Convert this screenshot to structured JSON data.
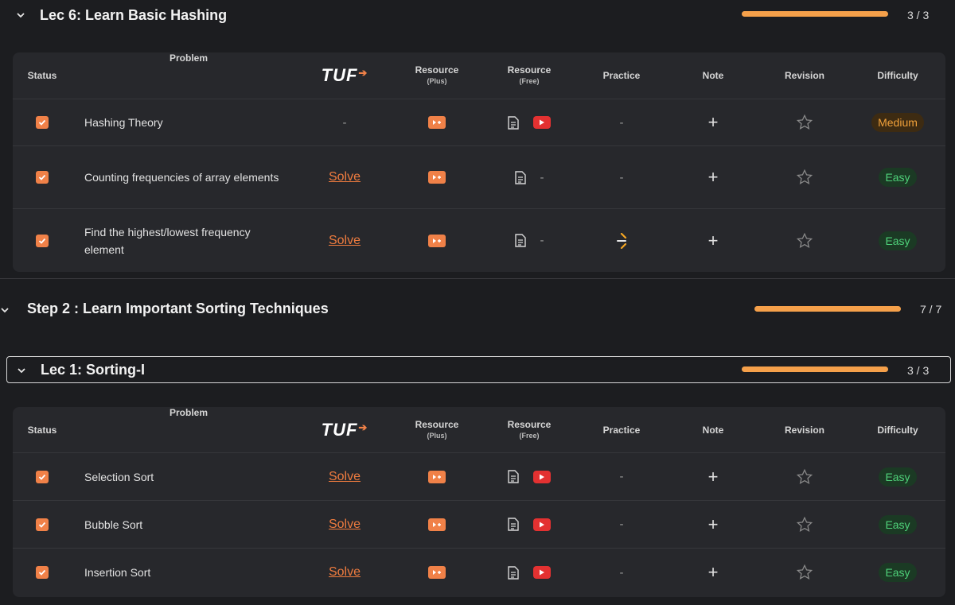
{
  "colors": {
    "accent": "#f08148",
    "progress": "#f5a04a",
    "easy": "#4fd27a",
    "medium": "#f1a13a",
    "youtube": "#e33131"
  },
  "table_headers": {
    "status": "Status",
    "problem": "Problem",
    "tuf": "TUF",
    "resource_plus": "Resource",
    "resource_plus_sub": "(Plus)",
    "resource_free": "Resource",
    "resource_free_sub": "(Free)",
    "practice": "Practice",
    "note": "Note",
    "revision": "Revision",
    "difficulty": "Difficulty"
  },
  "lec6": {
    "title": "Lec 6: Learn Basic Hashing",
    "progress_text": "3 / 3",
    "progress": 1.0,
    "problems": [
      {
        "name": "Hashing Theory",
        "tuf": "-",
        "free_article": true,
        "free_video": "youtube",
        "practice": "-",
        "difficulty": "Medium"
      },
      {
        "name": "Counting frequencies of array elements",
        "tuf": "Solve",
        "free_article": true,
        "free_video": "-",
        "practice": "-",
        "difficulty": "Easy"
      },
      {
        "name": "Find the highest/lowest frequency element",
        "tuf": "Solve",
        "free_article": true,
        "free_video": "-",
        "practice": "codestudio-icon",
        "difficulty": "Easy"
      }
    ]
  },
  "step2": {
    "title": "Step 2 : Learn Important Sorting Techniques",
    "progress_text": "7 / 7",
    "progress": 1.0
  },
  "lec1": {
    "title": "Lec 1: Sorting-I",
    "progress_text": "3 / 3",
    "progress": 1.0,
    "problems": [
      {
        "name": "Selection Sort",
        "tuf": "Solve",
        "free_article": true,
        "free_video": "youtube",
        "practice": "-",
        "difficulty": "Easy"
      },
      {
        "name": "Bubble Sort",
        "tuf": "Solve",
        "free_article": true,
        "free_video": "youtube",
        "practice": "-",
        "difficulty": "Easy"
      },
      {
        "name": "Insertion Sort",
        "tuf": "Solve",
        "free_article": true,
        "free_video": "youtube",
        "practice": "-",
        "difficulty": "Easy"
      }
    ]
  }
}
